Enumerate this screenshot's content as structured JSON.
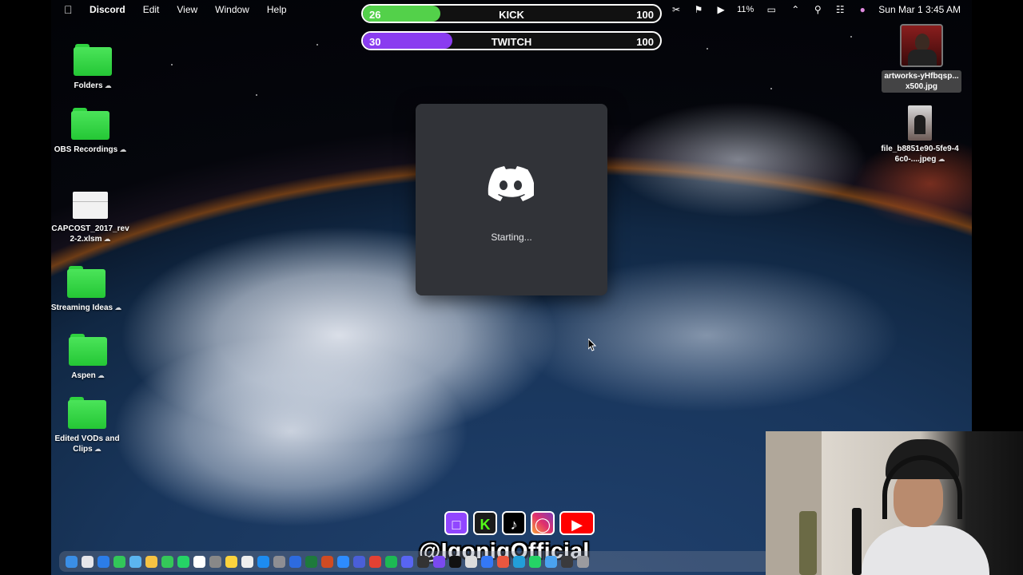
{
  "menubar": {
    "apple_icon": "apple-logo-icon",
    "app_name": "Discord",
    "menus": [
      "Edit",
      "View",
      "Window",
      "Help"
    ],
    "battery": "11%",
    "datetime": "Sun Mar 1  3:45 AM"
  },
  "goals": [
    {
      "current": "26",
      "name": "KICK",
      "max": "100",
      "progress": 0.26,
      "color": "#53d14a"
    },
    {
      "current": "30",
      "name": "TWITCH",
      "max": "100",
      "progress": 0.3,
      "color": "#8a3cf0"
    }
  ],
  "desktop_left": [
    {
      "label": "Folders",
      "kind": "folder"
    },
    {
      "label": "OBS Recordings",
      "kind": "folder"
    },
    {
      "label": "CAPCOST_2017_rev2-2.xlsm",
      "kind": "document"
    },
    {
      "label": "Streaming Ideas",
      "kind": "folder"
    },
    {
      "label": "Aspen",
      "kind": "folder"
    },
    {
      "label": "Edited VODs and Clips",
      "kind": "folder"
    }
  ],
  "desktop_right": [
    {
      "label": "artworks-yHfbqsp...x500.jpg",
      "kind": "image"
    },
    {
      "label": "file_b8851e90-5fe9-46c0-....jpeg",
      "kind": "image"
    }
  ],
  "splash": {
    "status": "Starting...",
    "logo_icon": "discord-logo-icon"
  },
  "overlay": {
    "handle": "@IqoniqOfficial",
    "socials": [
      "twitch-icon",
      "kick-icon",
      "tiktok-icon",
      "instagram-icon",
      "youtube-icon"
    ]
  },
  "colors": {
    "discord_bg": "#313338",
    "folder_green": "#2fd23f"
  }
}
